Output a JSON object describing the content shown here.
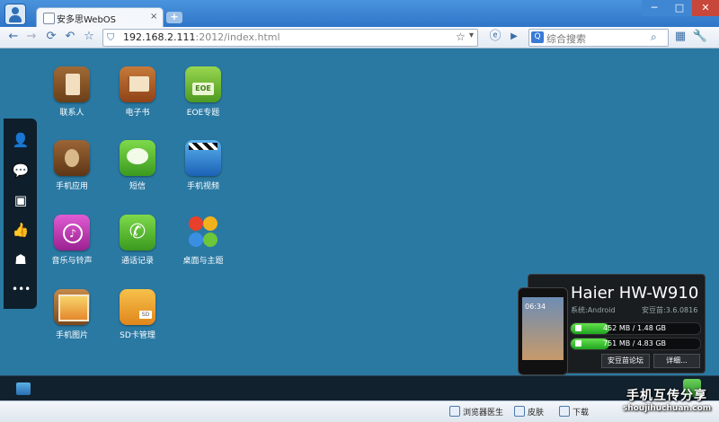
{
  "browser": {
    "tab_title": "安多思WebOS",
    "tab_close": "×",
    "new_tab": "+",
    "window_min": "─",
    "window_max": "□",
    "window_close": "✕",
    "url_host": "192.168.2.111",
    "url_rest": ":2012/index.html",
    "search_placeholder": "综合搜索",
    "search_engine_label": "Q"
  },
  "desktop": {
    "apps": [
      {
        "label": "联系人",
        "icon": "contacts-icon",
        "color": "#8a5a2b"
      },
      {
        "label": "电子书",
        "icon": "ebook-icon",
        "color": "#b0632a"
      },
      {
        "label": "EOE专题",
        "icon": "eoe-android-icon",
        "color": "#7cc13d"
      },
      {
        "label": "手机应用",
        "icon": "phone-apps-icon",
        "color": "#8a5a2b"
      },
      {
        "label": "短信",
        "icon": "sms-icon",
        "color": "#5ab52e"
      },
      {
        "label": "手机视频",
        "icon": "video-icon",
        "color": "#2b7bd0"
      },
      {
        "label": "音乐与铃声",
        "icon": "music-icon",
        "color": "#c43bb8"
      },
      {
        "label": "通话记录",
        "icon": "call-log-icon",
        "color": "#5ab52e"
      },
      {
        "label": "桌面与主题",
        "icon": "theme-icon",
        "color": "#7cc13d"
      },
      {
        "label": "手机图片",
        "icon": "photos-icon",
        "color": "#b0632a"
      },
      {
        "label": "SD卡管理",
        "icon": "sd-card-folder-icon",
        "color": "#e79a2a"
      }
    ]
  },
  "dock": {
    "items": [
      {
        "icon": "add-contact-icon",
        "glyph": "👤"
      },
      {
        "icon": "chat-icon",
        "glyph": "💬"
      },
      {
        "icon": "sd-card-icon",
        "glyph": "▣"
      },
      {
        "icon": "thumbs-up-icon",
        "glyph": "👍"
      },
      {
        "icon": "qq-penguin-icon",
        "glyph": "☗"
      },
      {
        "icon": "more-icon",
        "glyph": "•••"
      }
    ]
  },
  "device": {
    "name": "Haier HW-W910",
    "system": "系统:Android",
    "version": "安豆苗:3.6.0816",
    "phone_time": "06:34",
    "storage": [
      {
        "text": "452 MB / 1.48 GB",
        "fraction": 0.3
      },
      {
        "text": "751 MB / 4.83 GB",
        "fraction": 0.16
      }
    ],
    "forum_button": "安豆苗论坛",
    "details_button": "详细..."
  },
  "statusbar": {
    "doctor": "浏览器医生",
    "skin": "皮肤",
    "download": "下载"
  },
  "watermark": {
    "line1": "手机互传分享",
    "line2": "shoujihuchuan.com"
  }
}
